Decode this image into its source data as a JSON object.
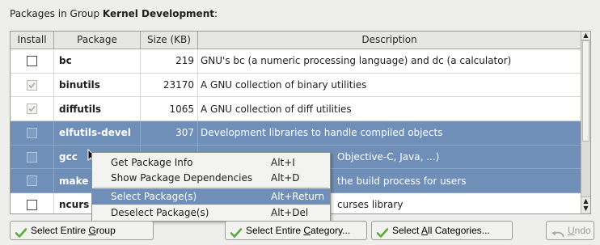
{
  "header": {
    "prefix": "Packages in Group ",
    "group": "Kernel Development",
    "suffix": ":"
  },
  "table": {
    "columns": [
      "Install",
      "Package",
      "Size (KB)",
      "Description"
    ],
    "rows": [
      {
        "package": "bc",
        "size": "219",
        "description": "GNU's bc (a numeric processing language) and dc (a calculator)",
        "state": "unchecked",
        "selected": false
      },
      {
        "package": "binutils",
        "size": "23170",
        "description": "A GNU collection of binary utilities",
        "state": "installed",
        "selected": false
      },
      {
        "package": "diffutils",
        "size": "1065",
        "description": "A GNU collection of diff utilities",
        "state": "installed",
        "selected": false
      },
      {
        "package": "elfutils-devel",
        "size": "307",
        "description": "Development libraries to handle compiled objects",
        "state": "unchecked",
        "selected": true
      },
      {
        "package": "gcc",
        "size": "",
        "description": "Objective-C, Java, ...)",
        "state": "unchecked",
        "selected": true
      },
      {
        "package": "make",
        "size": "",
        "description": "the build process for users",
        "state": "unchecked",
        "selected": true
      },
      {
        "package": "ncurs",
        "size": "",
        "description": "curses library",
        "state": "unchecked",
        "selected": false
      }
    ]
  },
  "context_menu": {
    "items": [
      {
        "label": "Get Package Info",
        "shortcut": "Alt+I",
        "highlighted": false
      },
      {
        "label": "Show Package Dependencies",
        "shortcut": "Alt+D",
        "highlighted": false
      },
      {
        "label": "Select Package(s)",
        "shortcut": "Alt+Return",
        "highlighted": true
      },
      {
        "label": "Deselect Package(s)",
        "shortcut": "Alt+Del",
        "highlighted": false
      }
    ]
  },
  "buttons": {
    "select_group": {
      "pre": "Select Entire ",
      "u": "G",
      "post": "roup"
    },
    "select_category": {
      "pre": "Select Entire ",
      "u": "C",
      "post": "ategory..."
    },
    "select_all": {
      "pre": "Select ",
      "u": "A",
      "post": "ll Categories..."
    },
    "undo": {
      "pre": "",
      "u": "U",
      "post": "ndo"
    }
  },
  "icons": {
    "check": "green-checkmark-icon",
    "undo": "undo-arrow-icon",
    "cursor": "mouse-pointer-icon"
  },
  "colors": {
    "selection": "#6f8fb8",
    "check_green": "#5fa83a"
  }
}
